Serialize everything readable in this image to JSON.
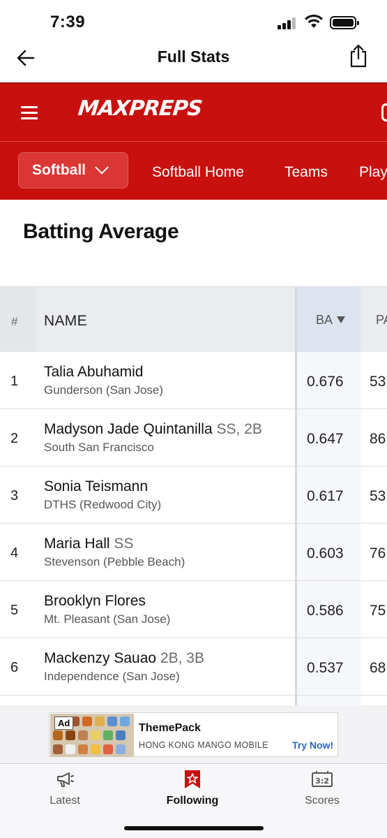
{
  "status": {
    "time": "7:39"
  },
  "header": {
    "title": "Full Stats"
  },
  "brand": {
    "logo_text": "MAXPREPS",
    "color": "#c8100e"
  },
  "sport_nav": {
    "selected_sport": "Softball",
    "links": [
      "Softball Home",
      "Teams",
      "Play"
    ]
  },
  "page": {
    "heading": "Batting Average"
  },
  "table": {
    "columns": {
      "rank": "#",
      "name": "NAME",
      "ba": "BA",
      "pa": "PA"
    },
    "rows": [
      {
        "rank": "1",
        "name": "Talia Abuhamid",
        "position": "",
        "school": "Gunderson (San Jose)",
        "ba": "0.676",
        "pa": "53"
      },
      {
        "rank": "2",
        "name": "Madyson Jade Quintanilla",
        "position": "SS, 2B",
        "school": "South San Francisco",
        "ba": "0.647",
        "pa": "86"
      },
      {
        "rank": "3",
        "name": "Sonia Teismann",
        "position": "",
        "school": "DTHS (Redwood City)",
        "ba": "0.617",
        "pa": "53"
      },
      {
        "rank": "4",
        "name": "Maria Hall",
        "position": "SS",
        "school": "Stevenson (Pebble Beach)",
        "ba": "0.603",
        "pa": "76"
      },
      {
        "rank": "5",
        "name": "Brooklyn Flores",
        "position": "",
        "school": "Mt. Pleasant (San Jose)",
        "ba": "0.586",
        "pa": "75"
      },
      {
        "rank": "6",
        "name": "Mackenzy Sauao",
        "position": "2B, 3B",
        "school": "Independence (San Jose)",
        "ba": "0.537",
        "pa": "68"
      }
    ]
  },
  "ad": {
    "badge": "Ad",
    "title": "ThemePack",
    "advertiser": "HONG KONG MANGO MOBILE Lt",
    "cta": "Try Now!"
  },
  "tabbar": {
    "tabs": [
      {
        "label": "Latest",
        "icon": "megaphone-icon"
      },
      {
        "label": "Following",
        "icon": "star-bookmark-icon"
      },
      {
        "label": "Scores",
        "icon": "scoreboard-icon"
      }
    ],
    "active_index": 1
  }
}
